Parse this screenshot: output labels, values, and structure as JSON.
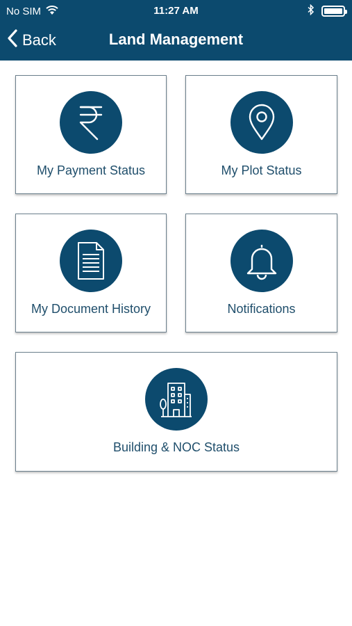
{
  "status": {
    "carrier": "No SIM",
    "time": "11:27 AM"
  },
  "nav": {
    "back_label": "Back",
    "title": "Land Management"
  },
  "tiles": [
    {
      "label": "My Payment Status",
      "icon": "rupee-icon"
    },
    {
      "label": "My Plot Status",
      "icon": "location-pin-icon"
    },
    {
      "label": "My Document History",
      "icon": "document-icon"
    },
    {
      "label": "Notifications",
      "icon": "bell-icon"
    },
    {
      "label": "Building & NOC Status",
      "icon": "building-icon"
    }
  ],
  "colors": {
    "brand": "#0c4a6e",
    "tile_text": "#1f4e6b",
    "tile_border": "#6b7f8c",
    "background": "#ffffff"
  }
}
